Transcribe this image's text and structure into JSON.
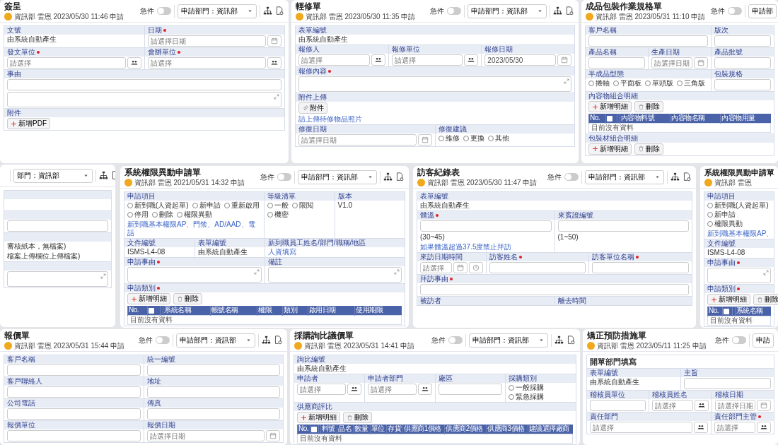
{
  "tiles": [
    {
      "title": "簽呈",
      "meta": "資訊部 雷恩 2023/05/30 11:46 申請",
      "urgent_label": "急件",
      "urgent": false,
      "department_select": "申請部門：資訊部",
      "rows": [
        {
          "fields": [
            {
              "label": "文號",
              "required": false,
              "items": [
                {
                  "kind": "text",
                  "text": "由系統自動產生"
                }
              ]
            },
            {
              "label": "日期",
              "required": true,
              "items": [
                {
                  "kind": "date",
                  "placeholder": "請選擇日期"
                }
              ]
            }
          ]
        },
        {
          "fields": [
            {
              "label": "發文單位",
              "required": true,
              "items": [
                {
                  "kind": "picker",
                  "placeholder": "請選擇"
                }
              ]
            },
            {
              "label": "會辦單位",
              "required": true,
              "items": [
                {
                  "kind": "picker",
                  "placeholder": "請選擇"
                }
              ]
            }
          ]
        },
        {
          "fields": [
            {
              "label": "事由",
              "required": false,
              "items": [
                {
                  "kind": "input"
                },
                {
                  "kind": "textarea"
                }
              ]
            }
          ]
        },
        {
          "fields": [
            {
              "label": "附件",
              "required": false,
              "items": [
                {
                  "kind": "toolbar",
                  "buttons": [
                    {
                      "kind": "add",
                      "label": "新增PDF"
                    }
                  ]
                }
              ]
            }
          ]
        }
      ]
    },
    {
      "title": "輕修單",
      "meta": "資訊部 雷恩 2023/05/30 11:35 申請",
      "urgent_label": "急件",
      "urgent": false,
      "department_select": "申請部門：資訊部",
      "rows": [
        {
          "fields": [
            {
              "label": "表單編號",
              "required": false,
              "items": [
                {
                  "kind": "text",
                  "text": "由系統自動產生"
                }
              ]
            }
          ]
        },
        {
          "fields": [
            {
              "label": "報修人",
              "required": false,
              "items": [
                {
                  "kind": "picker",
                  "placeholder": "請選擇"
                }
              ]
            },
            {
              "label": "報修單位",
              "required": false,
              "items": [
                {
                  "kind": "picker",
                  "placeholder": "請選擇"
                }
              ]
            },
            {
              "label": "報修日期",
              "required": false,
              "items": [
                {
                  "kind": "date",
                  "value": "2023/05/30"
                }
              ]
            }
          ]
        },
        {
          "fields": [
            {
              "label": "報修內容",
              "required": true,
              "items": [
                {
                  "kind": "textarea"
                }
              ]
            }
          ]
        },
        {
          "fields": [
            {
              "label": "附件上傳",
              "required": false,
              "items": [
                {
                  "kind": "toolbar",
                  "buttons": [
                    {
                      "kind": "attach",
                      "label": "附件"
                    }
                  ]
                },
                {
                  "kind": "hint",
                  "text": "請上傳待修物品照片"
                }
              ]
            }
          ]
        },
        {
          "fields": [
            {
              "label": "修復日期",
              "required": false,
              "items": [
                {
                  "kind": "date",
                  "placeholder": "請選擇日期"
                }
              ]
            },
            {
              "label": "修復建議",
              "required": false,
              "items": [
                {
                  "kind": "radios",
                  "options": [
                    {
                      "label": "維修",
                      "selected": false
                    },
                    {
                      "label": "更換",
                      "selected": false
                    },
                    {
                      "label": "其他",
                      "selected": false
                    }
                  ]
                }
              ]
            }
          ]
        }
      ]
    },
    {
      "title": "成品包裝作業規格單",
      "meta": "資訊部 雷恩 2023/05/31 11:10 申請",
      "urgent_label": "急件",
      "urgent": false,
      "department_select": "申請部",
      "rows": [
        {
          "fields": [
            {
              "label": "客戶名稱",
              "required": false,
              "items": [
                {
                  "kind": "input"
                }
              ]
            },
            {
              "label": "版次",
              "required": false,
              "items": [
                {
                  "kind": "input"
                }
              ]
            }
          ]
        },
        {
          "fields": [
            {
              "label": "產品名稱",
              "required": false,
              "items": [
                {
                  "kind": "input"
                }
              ]
            },
            {
              "label": "生產日期",
              "required": false,
              "items": [
                {
                  "kind": "date",
                  "placeholder": "請選擇日期"
                }
              ]
            },
            {
              "label": "產品批號",
              "required": false,
              "items": [
                {
                  "kind": "input"
                }
              ]
            }
          ]
        },
        {
          "fields": [
            {
              "label": "半成品型態",
              "required": false,
              "items": [
                {
                  "kind": "radios",
                  "options": [
                    {
                      "label": "捲軸",
                      "selected": false
                    },
                    {
                      "label": "平面板",
                      "selected": false
                    },
                    {
                      "label": "單頭版",
                      "selected": false
                    },
                    {
                      "label": "三角版",
                      "selected": false
                    }
                  ]
                }
              ]
            },
            {
              "label": "包裝規格",
              "required": false,
              "items": [
                {
                  "kind": "input"
                }
              ]
            }
          ]
        },
        {
          "fields": [
            {
              "label": "內容物組合明細",
              "required": false,
              "items": [
                {
                  "kind": "toolbar",
                  "buttons": [
                    {
                      "kind": "add",
                      "label": "新增明細"
                    },
                    {
                      "kind": "delete",
                      "label": "刪除"
                    }
                  ]
                },
                {
                  "kind": "table",
                  "number_label": "No.",
                  "select_all": false,
                  "columns": [
                    "內容物料號",
                    "內容物名稱",
                    "內容物用量"
                  ],
                  "empty": "目前沒有資料"
                }
              ]
            }
          ]
        },
        {
          "fields": [
            {
              "label": "包裝材組合明細",
              "required": false,
              "items": [
                {
                  "kind": "toolbar",
                  "buttons": [
                    {
                      "kind": "add",
                      "label": "新增明細"
                    },
                    {
                      "kind": "delete",
                      "label": "刪除"
                    }
                  ]
                }
              ]
            }
          ]
        }
      ]
    },
    {
      "department_select": "部門：資訊部",
      "rows": [
        {
          "kind": "blank"
        },
        {
          "fields": [
            {
              "items": [
                {
                  "kind": "input"
                }
              ]
            }
          ]
        },
        {
          "fields": [
            {
              "items": [
                {
                  "kind": "text",
                  "text": "審核紙本，無檔案)"
                },
                {
                  "kind": "text",
                  "text": "檔案上傳欄位上傳檔案)"
                }
              ]
            }
          ]
        },
        {
          "fields": [
            {
              "items": [
                {
                  "kind": "textarea"
                }
              ]
            }
          ]
        }
      ]
    },
    {
      "title": "系統權限異動申請單",
      "meta": "資訊部 雷恩 2021/05/31 14:32 申請",
      "urgent_label": "急件",
      "urgent": false,
      "department_select": "申請部門：資訊部",
      "rows": [
        {
          "fields": [
            {
              "label": "申請項目",
              "required": false,
              "items": [
                {
                  "kind": "radios",
                  "options": [
                    {
                      "label": "新到職(人資起單)",
                      "selected": false
                    },
                    {
                      "label": "新申請",
                      "selected": false
                    },
                    {
                      "label": "重新啟用",
                      "selected": false
                    },
                    {
                      "label": "停用",
                      "selected": false
                    },
                    {
                      "label": "刪除",
                      "selected": false
                    },
                    {
                      "label": "權限異動",
                      "selected": false
                    }
                  ]
                },
                {
                  "kind": "hint",
                  "text": "新到職基本權限AP、門禁、AD/AAD、電話"
                }
              ]
            },
            {
              "label": "等級清單",
              "required": false,
              "items": [
                {
                  "kind": "radios",
                  "options": [
                    {
                      "label": "一般",
                      "selected": false
                    },
                    {
                      "label": "限閱",
                      "selected": false
                    },
                    {
                      "label": "機密",
                      "selected": false
                    }
                  ]
                }
              ]
            },
            {
              "label": "版本",
              "required": false,
              "items": [
                {
                  "kind": "text",
                  "text": "V1.0"
                }
              ]
            }
          ]
        },
        {
          "fields": [
            {
              "label": "文件編號",
              "required": false,
              "items": [
                {
                  "kind": "text",
                  "text": "ISMS-L4-08"
                }
              ]
            },
            {
              "label": "表單編號",
              "required": false,
              "items": [
                {
                  "kind": "text",
                  "text": "由系統自動產生"
                }
              ]
            },
            {
              "label": "新到職員工姓名/部門/職稱/地區",
              "required": false,
              "items": [
                {
                  "kind": "hint",
                  "text": "人資填寫"
                }
              ]
            }
          ]
        },
        {
          "fields": [
            {
              "label": "申請事由",
              "required": true,
              "items": [
                {
                  "kind": "textarea"
                }
              ]
            },
            {
              "label": "備註",
              "required": false,
              "items": [
                {
                  "kind": "textarea"
                }
              ]
            }
          ]
        },
        {
          "fields": [
            {
              "label": "申請類別",
              "required": true,
              "items": [
                {
                  "kind": "toolbar",
                  "buttons": [
                    {
                      "kind": "add",
                      "label": "新增明細"
                    },
                    {
                      "kind": "delete",
                      "label": "刪除"
                    }
                  ]
                },
                {
                  "kind": "table",
                  "number_label": "No.",
                  "select_all": false,
                  "columns": [
                    "系統名稱",
                    "帳號名稱",
                    "權限",
                    "類別",
                    "啟用日期",
                    "使用期限"
                  ],
                  "empty": "目前沒有資料"
                }
              ]
            }
          ]
        }
      ]
    },
    {
      "title": "訪客紀錄表",
      "meta": "資訊部 雷恩 2023/05/30 11:47 申請",
      "urgent_label": "急件",
      "urgent": false,
      "department_select": "申請部門：資訊部",
      "rows": [
        {
          "fields": [
            {
              "label": "表單編號",
              "required": false,
              "items": [
                {
                  "kind": "text",
                  "text": "由系統自動產生"
                }
              ]
            }
          ]
        },
        {
          "fields": [
            {
              "label": "體溫",
              "required": true,
              "items": [
                {
                  "kind": "input"
                },
                {
                  "kind": "text",
                  "text": "(30~45)"
                },
                {
                  "kind": "hint",
                  "text": "如果體溫超過37.5度禁止拜訪"
                }
              ]
            },
            {
              "label": "來賓證編號",
              "required": false,
              "items": [
                {
                  "kind": "input"
                },
                {
                  "kind": "text",
                  "text": "(1~50)"
                }
              ]
            }
          ]
        },
        {
          "fields": [
            {
              "label": "來訪日期時間",
              "required": false,
              "items": [
                {
                  "kind": "datetime",
                  "placeholder": "請選擇"
                }
              ]
            },
            {
              "label": "訪客姓名",
              "required": true,
              "items": [
                {
                  "kind": "input"
                }
              ]
            },
            {
              "label": "訪客單位名稱",
              "required": true,
              "items": [
                {
                  "kind": "input"
                }
              ]
            }
          ]
        },
        {
          "fields": [
            {
              "label": "拜訪事由",
              "required": true,
              "items": [
                {
                  "kind": "input"
                }
              ]
            }
          ]
        },
        {
          "fields": [
            {
              "label": "被訪者",
              "required": false
            },
            {
              "label": "離去時間",
              "required": false
            }
          ]
        }
      ]
    },
    {
      "title": "系統權限異動申請單",
      "meta": "資訊部 雷恩",
      "rows": [
        {
          "fields": [
            {
              "label": "申請項目",
              "required": false,
              "items": [
                {
                  "kind": "radios",
                  "options": [
                    {
                      "label": "新到職(人資起單)",
                      "selected": false
                    },
                    {
                      "label": "新申請",
                      "selected": false
                    },
                    {
                      "label": "權限異動",
                      "selected": false
                    }
                  ]
                },
                {
                  "kind": "hint",
                  "text": "新到職基本權限AP、"
                }
              ]
            }
          ]
        },
        {
          "fields": [
            {
              "label": "文件編號",
              "required": false,
              "items": [
                {
                  "kind": "text",
                  "text": "ISMS-L4-08"
                }
              ]
            }
          ]
        },
        {
          "fields": [
            {
              "label": "申請事由",
              "required": true,
              "items": [
                {
                  "kind": "textarea"
                }
              ]
            }
          ]
        },
        {
          "fields": [
            {
              "label": "申請類別",
              "required": true,
              "items": [
                {
                  "kind": "toolbar",
                  "buttons": [
                    {
                      "kind": "add",
                      "label": "新增明細"
                    },
                    {
                      "kind": "delete",
                      "label": "刪除"
                    }
                  ]
                },
                {
                  "kind": "table",
                  "number_label": "No.",
                  "select_all": false,
                  "columns": [
                    "系統名稱"
                  ],
                  "empty": "目前沒有資料"
                }
              ]
            }
          ]
        }
      ]
    },
    {
      "title": "報價單",
      "meta": "資訊部 雷恩 2023/05/31 15:44 申請",
      "urgent_label": "急件",
      "urgent": false,
      "department_select": "申請部門：資訊部",
      "rows": [
        {
          "fields": [
            {
              "label": "客戶名稱",
              "required": false,
              "items": [
                {
                  "kind": "input"
                }
              ]
            },
            {
              "label": "統一編號",
              "required": false,
              "items": [
                {
                  "kind": "input"
                }
              ]
            }
          ]
        },
        {
          "fields": [
            {
              "label": "客戶聯絡人",
              "required": false,
              "items": [
                {
                  "kind": "input"
                }
              ]
            },
            {
              "label": "地址",
              "required": false,
              "items": [
                {
                  "kind": "input"
                }
              ]
            }
          ]
        },
        {
          "fields": [
            {
              "label": "公司電話",
              "required": false,
              "items": [
                {
                  "kind": "input"
                }
              ]
            },
            {
              "label": "傳真",
              "required": false,
              "items": [
                {
                  "kind": "input"
                }
              ]
            }
          ]
        },
        {
          "fields": [
            {
              "label": "報價單位",
              "required": false,
              "items": [
                {
                  "kind": "input"
                }
              ]
            },
            {
              "label": "報價日期",
              "required": false,
              "items": [
                {
                  "kind": "date",
                  "placeholder": "請選擇日期"
                }
              ]
            }
          ]
        }
      ]
    },
    {
      "title": "採購詢比議價單",
      "meta": "資訊部 雷恩 2023/05/31 14:41 申請",
      "urgent_label": "急件",
      "urgent": false,
      "department_select": "申請部門：資訊部",
      "rows": [
        {
          "fields": [
            {
              "label": "詢比編號",
              "required": false,
              "items": [
                {
                  "kind": "text",
                  "text": "由系統自動產生"
                }
              ]
            }
          ]
        },
        {
          "fields": [
            {
              "label": "申請者",
              "required": false,
              "items": [
                {
                  "kind": "picker",
                  "placeholder": "請選擇"
                }
              ]
            },
            {
              "label": "申請者部門",
              "required": false,
              "items": [
                {
                  "kind": "picker",
                  "placeholder": "請選擇"
                }
              ]
            },
            {
              "label": "廠區",
              "required": false,
              "items": [
                {
                  "kind": "input"
                }
              ]
            },
            {
              "label": "採購類別",
              "required": false,
              "items": [
                {
                  "kind": "radios",
                  "options": [
                    {
                      "label": "一般採購",
                      "selected": false
                    },
                    {
                      "label": "緊急採購",
                      "selected": false
                    }
                  ]
                }
              ]
            }
          ]
        },
        {
          "fields": [
            {
              "label": "供應商評比",
              "required": false,
              "items": [
                {
                  "kind": "toolbar",
                  "buttons": [
                    {
                      "kind": "add",
                      "label": "新增明細"
                    },
                    {
                      "kind": "delete",
                      "label": "刪除"
                    }
                  ]
                },
                {
                  "kind": "table",
                  "number_label": "No.",
                  "select_all": false,
                  "columns": [
                    "料號",
                    "品名",
                    "數量",
                    "單位",
                    "存貨",
                    "供應商1價格",
                    "供應商2價格",
                    "供應商3價格",
                    "建議選擇廠商"
                  ],
                  "empty": "目前沒有資料"
                }
              ]
            }
          ]
        }
      ]
    },
    {
      "title": "矯正預防措施單",
      "meta": "資訊部 雷恩 2023/05/11 11:25 申請",
      "urgent_label": "急件",
      "urgent": false,
      "department_select": "申請",
      "rows": [
        {
          "fields": [
            {
              "items": [
                {
                  "kind": "heading",
                  "text": "開單部門填寫"
                }
              ]
            }
          ]
        },
        {
          "fields": [
            {
              "label": "表單編號",
              "required": false,
              "items": [
                {
                  "kind": "text",
                  "text": "由系統自動產生"
                }
              ]
            },
            {
              "label": "主旨",
              "required": false,
              "items": [
                {
                  "kind": "input"
                }
              ]
            }
          ]
        },
        {
          "fields": [
            {
              "label": "稽核員單位",
              "required": false,
              "items": [
                {
                  "kind": "input"
                }
              ]
            },
            {
              "label": "稽核員姓名",
              "required": false,
              "items": [
                {
                  "kind": "picker",
                  "placeholder": "請選擇"
                }
              ]
            },
            {
              "label": "稽核日期",
              "required": false,
              "items": [
                {
                  "kind": "date",
                  "placeholder": "請選擇日期"
                }
              ]
            }
          ]
        },
        {
          "fields": [
            {
              "label": "責任部門",
              "required": false,
              "items": [
                {
                  "kind": "picker",
                  "placeholder": "請選擇"
                }
              ]
            },
            {
              "label": "責任部門主管",
              "required": true,
              "items": [
                {
                  "kind": "picker",
                  "placeholder": "請選擇"
                }
              ]
            }
          ]
        }
      ]
    }
  ]
}
